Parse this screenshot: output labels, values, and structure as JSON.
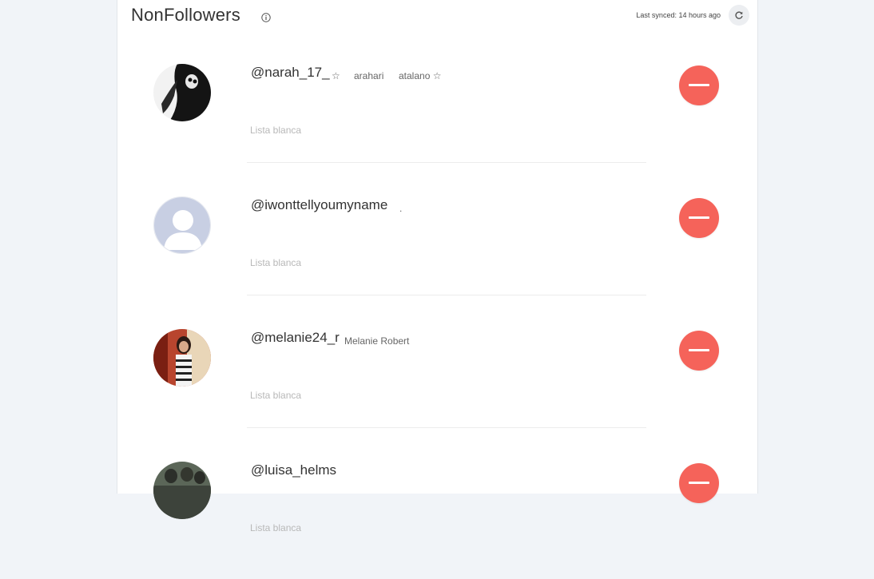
{
  "header": {
    "title": "NonFollowers",
    "last_synced": "Last synced: 14 hours ago"
  },
  "rows": [
    {
      "username": "@narah_17_",
      "meta": [
        "☆",
        "arahari",
        "atalano ☆"
      ],
      "whitelist_label": "Lista blanca"
    },
    {
      "username": "@iwonttellyoumyname",
      "meta": [
        "."
      ],
      "whitelist_label": "Lista blanca"
    },
    {
      "username": "@melanie24_r",
      "meta": [
        "Melanie Robert"
      ],
      "whitelist_label": "Lista blanca"
    },
    {
      "username": "@luisa_helms",
      "meta": [],
      "whitelist_label": "Lista blanca"
    }
  ],
  "colors": {
    "background": "#f1f4f8",
    "panel": "#ffffff",
    "remove_button": "#f5635a",
    "placeholder_avatar": "#c8cfe3"
  }
}
